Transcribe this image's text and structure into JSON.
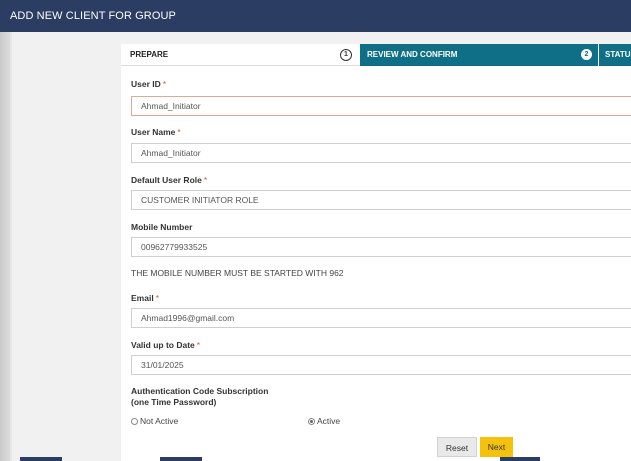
{
  "header": {
    "title": "ADD NEW CLIENT FOR GROUP"
  },
  "steps": [
    {
      "label": "PREPARE",
      "number": "1"
    },
    {
      "label": "REVIEW AND CONFIRM",
      "number": "2"
    },
    {
      "label": "STATUS"
    }
  ],
  "required_marker": "*",
  "fields": {
    "user_id": {
      "label": "User ID",
      "value": "Ahmad_Initiator"
    },
    "user_name": {
      "label": "User Name",
      "value": "Ahmad_Initiator"
    },
    "default_role": {
      "label": "Default User Role",
      "value": "CUSTOMER INITIATOR ROLE"
    },
    "mobile": {
      "label": "Mobile Number",
      "value": "00962779933525"
    },
    "mobile_note": "THE MOBILE NUMBER MUST BE STARTED WITH 962",
    "email": {
      "label": "Email",
      "value": "Ahmad1996@gmail.com"
    },
    "valid_date": {
      "label": "Valid up to Date",
      "value": "31/01/2025"
    }
  },
  "auth": {
    "label_line1": "Authentication Code Subscription",
    "label_line2": "(one Time Password)",
    "options": [
      {
        "label": "Not Active",
        "selected": false
      },
      {
        "label": "Active",
        "selected": true
      }
    ]
  },
  "buttons": {
    "reset": "Reset",
    "next": "Next"
  },
  "colors": {
    "header": "#2b3d63",
    "step_active": "#0f6f86",
    "next_button": "#f4c20d",
    "required": "#d9534f"
  }
}
